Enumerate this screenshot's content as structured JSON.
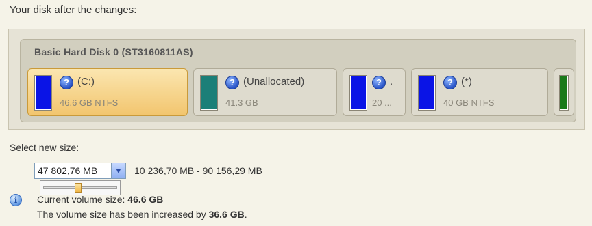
{
  "header": {
    "title": "Your disk after the changes:"
  },
  "disk": {
    "title": "Basic Hard Disk 0 (ST3160811AS)",
    "partitions": [
      {
        "name": "(C:)",
        "info": "46.6 GB NTFS",
        "color": "#0a14e6",
        "selected": true
      },
      {
        "name": "(Unallocated)",
        "info": "41.3 GB",
        "color": "#1b7f78",
        "selected": false
      },
      {
        "name": ".",
        "info": "20 ...",
        "color": "#0a14e6",
        "selected": false
      },
      {
        "name": "(*)",
        "info": "40 GB NTFS",
        "color": "#0a14e6",
        "selected": false
      },
      {
        "name": "",
        "info": "",
        "color": "#1a7a1a",
        "selected": false
      }
    ]
  },
  "size_selector": {
    "label": "Select new size:",
    "value": "47 802,76 MB",
    "range": "10 236,70 MB - 90 156,29 MB",
    "slider_fraction": 0.47
  },
  "info": {
    "current_label": "Current volume size:",
    "current_value": "46.6 GB",
    "increase_prefix": "The volume size has been increased by",
    "increase_value": "36.6 GB",
    "increase_suffix": "."
  },
  "icons": {
    "help": "question-icon",
    "info": "info-icon",
    "dropdown": "chevron-down-icon"
  }
}
